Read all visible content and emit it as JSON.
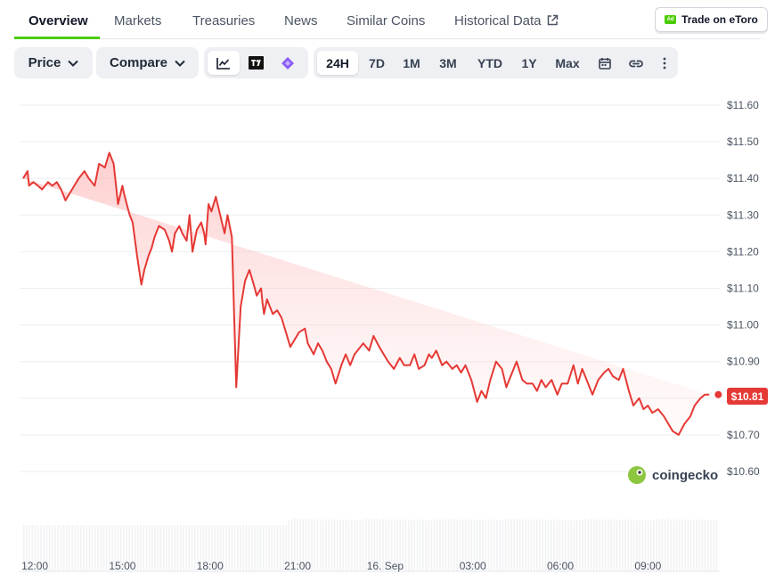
{
  "tabs": [
    {
      "label": "Overview"
    },
    {
      "label": "Markets"
    },
    {
      "label": "Treasuries"
    },
    {
      "label": "News"
    },
    {
      "label": "Similar Coins"
    },
    {
      "label": "Historical Data"
    }
  ],
  "trade": {
    "badge": "Ad",
    "label": "Trade on eToro"
  },
  "controls": {
    "price_label": "Price",
    "compare_label": "Compare",
    "view_icons": [
      "line-chart-icon",
      "tradingview-icon",
      "diamond-icon"
    ],
    "ranges": [
      "24H",
      "7D",
      "1M",
      "3M",
      "YTD",
      "1Y",
      "Max"
    ],
    "active_range": "24H",
    "extra_icons": [
      "calendar-icon",
      "link-icon",
      "more-vertical-icon"
    ]
  },
  "colors": {
    "accent": "#4bcc00",
    "line": "#e53935",
    "fill": "#fde2e2"
  },
  "watermark": "coingecko",
  "current_price_label": "$10.81",
  "chart_data": {
    "type": "area",
    "ylim": [
      10.6,
      11.6
    ],
    "yticks": [
      10.6,
      10.7,
      10.8,
      10.9,
      11.0,
      11.1,
      11.2,
      11.3,
      11.4,
      11.5,
      11.6
    ],
    "ytick_labels": [
      "$10.60",
      "$10.70",
      "$10.80",
      "$10.90",
      "$11.00",
      "$11.10",
      "$11.20",
      "$11.30",
      "$11.40",
      "$11.50",
      "$11.60"
    ],
    "xlim": [
      11.6,
      35.4
    ],
    "xticks": [
      12,
      15,
      18,
      21,
      24,
      27,
      30,
      33
    ],
    "xtick_labels": [
      "12:00",
      "15:00",
      "18:00",
      "21:00",
      "16. Sep",
      "03:00",
      "06:00",
      "09:00"
    ],
    "grid": true,
    "x": [
      11.6,
      11.75,
      11.8,
      11.95,
      12.1,
      12.25,
      12.45,
      12.6,
      12.75,
      12.9,
      13.05,
      13.2,
      13.35,
      13.5,
      13.7,
      13.85,
      14.05,
      14.2,
      14.4,
      14.55,
      14.7,
      14.85,
      15.0,
      15.05,
      15.15,
      15.25,
      15.35,
      15.5,
      15.65,
      15.75,
      15.9,
      16.0,
      16.1,
      16.25,
      16.45,
      16.6,
      16.7,
      16.8,
      16.95,
      17.05,
      17.2,
      17.3,
      17.4,
      17.55,
      17.7,
      17.8,
      17.85,
      17.95,
      18.05,
      18.2,
      18.35,
      18.5,
      18.6,
      18.75,
      18.9,
      19.05,
      19.2,
      19.35,
      19.5,
      19.6,
      19.75,
      19.8,
      19.85,
      19.95,
      20.05,
      20.15,
      20.3,
      20.45,
      20.6,
      20.75,
      20.9,
      21.05,
      21.25,
      21.35,
      21.55,
      21.7,
      21.85,
      22.0,
      22.15,
      22.3,
      22.5,
      22.65,
      22.8,
      22.95,
      23.05,
      23.25,
      23.45,
      23.6,
      23.8,
      23.95,
      24.1,
      24.3,
      24.5,
      24.65,
      24.85,
      25.0,
      25.15,
      25.35,
      25.5,
      25.6,
      25.75,
      25.95,
      26.1,
      26.3,
      26.45,
      26.6,
      26.75,
      26.95,
      27.15,
      27.3,
      27.45,
      27.6,
      27.8,
      28.0,
      28.15,
      28.3,
      28.5,
      28.7,
      28.85,
      29.05,
      29.2,
      29.35,
      29.5,
      29.7,
      29.9,
      30.05,
      30.25,
      30.45,
      30.6,
      30.75,
      30.95,
      31.1,
      31.3,
      31.5,
      31.65,
      31.8,
      32.0,
      32.15,
      32.35,
      32.5,
      32.7,
      32.85,
      33.0,
      33.15,
      33.35,
      33.55,
      33.7,
      33.85,
      34.05,
      34.25,
      34.45,
      34.6,
      34.8,
      34.95,
      35.1,
      35.2,
      35.35
    ],
    "series": [
      {
        "values": [
          11.4,
          11.42,
          11.38,
          11.39,
          11.38,
          11.37,
          11.39,
          11.38,
          11.39,
          11.37,
          11.34,
          11.36,
          11.38,
          11.4,
          11.42,
          11.4,
          11.38,
          11.44,
          11.43,
          11.47,
          11.44,
          11.33,
          11.38,
          11.36,
          11.33,
          11.3,
          11.28,
          11.19,
          11.11,
          11.15,
          11.19,
          11.21,
          11.24,
          11.27,
          11.26,
          11.23,
          11.2,
          11.25,
          11.27,
          11.25,
          11.23,
          11.3,
          11.2,
          11.26,
          11.28,
          11.25,
          11.22,
          11.33,
          11.31,
          11.35,
          11.3,
          11.25,
          11.3,
          11.24,
          10.83,
          11.05,
          11.12,
          11.15,
          11.11,
          11.08,
          11.1,
          11.06,
          11.03,
          11.07,
          11.05,
          11.03,
          11.04,
          11.02,
          10.98,
          10.94,
          10.96,
          10.98,
          10.99,
          10.95,
          10.92,
          10.95,
          10.93,
          10.9,
          10.88,
          10.84,
          10.89,
          10.92,
          10.89,
          10.92,
          10.93,
          10.95,
          10.93,
          10.97,
          10.94,
          10.92,
          10.9,
          10.88,
          10.91,
          10.89,
          10.89,
          10.92,
          10.88,
          10.89,
          10.92,
          10.91,
          10.93,
          10.89,
          10.9,
          10.88,
          10.89,
          10.87,
          10.89,
          10.85,
          10.79,
          10.82,
          10.8,
          10.85,
          10.9,
          10.88,
          10.83,
          10.86,
          10.9,
          10.85,
          10.84,
          10.84,
          10.82,
          10.85,
          10.83,
          10.85,
          10.81,
          10.84,
          10.84,
          10.89,
          10.84,
          10.88,
          10.84,
          10.81,
          10.85,
          10.87,
          10.88,
          10.86,
          10.85,
          10.88,
          10.82,
          10.78,
          10.8,
          10.77,
          10.78,
          10.76,
          10.77,
          10.75,
          10.73,
          10.71,
          10.7,
          10.73,
          10.75,
          10.78,
          10.8,
          10.81,
          10.81
        ]
      }
    ],
    "volume_note": "bars",
    "current_value": 10.81
  }
}
